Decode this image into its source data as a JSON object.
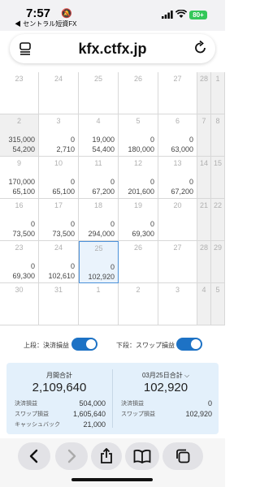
{
  "status": {
    "time": "7:57",
    "carrier": "◀ セントラル短資FX",
    "battery": "80+"
  },
  "browser": {
    "url": "kfx.ctfx.jp"
  },
  "calendar": {
    "rows": [
      [
        {
          "d": "23"
        },
        {
          "d": "24"
        },
        {
          "d": "25"
        },
        {
          "d": "26"
        },
        {
          "d": "27"
        },
        {
          "d": "28"
        },
        {
          "d": "1"
        }
      ],
      [
        {
          "d": "2",
          "v1": "315,000",
          "v2": "54,200"
        },
        {
          "d": "3",
          "v1": "0",
          "v2": "2,710"
        },
        {
          "d": "4",
          "v1": "19,000",
          "v2": "54,400"
        },
        {
          "d": "5",
          "v1": "0",
          "v2": "180,000"
        },
        {
          "d": "6",
          "v1": "0",
          "v2": "63,000"
        },
        {
          "d": "7"
        },
        {
          "d": "8"
        }
      ],
      [
        {
          "d": "9",
          "v1": "170,000",
          "v2": "65,100"
        },
        {
          "d": "10",
          "v1": "0",
          "v2": "65,100"
        },
        {
          "d": "11",
          "v1": "0",
          "v2": "67,200"
        },
        {
          "d": "12",
          "v1": "0",
          "v2": "201,600"
        },
        {
          "d": "13",
          "v1": "0",
          "v2": "67,200"
        },
        {
          "d": "14"
        },
        {
          "d": "15"
        }
      ],
      [
        {
          "d": "16",
          "v1": "0",
          "v2": "73,500"
        },
        {
          "d": "17",
          "v1": "0",
          "v2": "73,500"
        },
        {
          "d": "18",
          "v1": "0",
          "v2": "294,000"
        },
        {
          "d": "19",
          "v1": "0",
          "v2": "69,300"
        },
        {
          "d": "20"
        },
        {
          "d": "21"
        },
        {
          "d": "22"
        }
      ],
      [
        {
          "d": "23",
          "v1": "0",
          "v2": "69,300"
        },
        {
          "d": "24",
          "v1": "0",
          "v2": "102,610"
        },
        {
          "d": "25",
          "v1": "0",
          "v2": "102,920"
        },
        {
          "d": "26"
        },
        {
          "d": "27"
        },
        {
          "d": "28"
        },
        {
          "d": "29"
        }
      ],
      [
        {
          "d": "30"
        },
        {
          "d": "31"
        },
        {
          "d": "1"
        },
        {
          "d": "2"
        },
        {
          "d": "3"
        },
        {
          "d": "4"
        },
        {
          "d": "5"
        }
      ]
    ]
  },
  "toggles": {
    "upper_label": "上段：決済損益",
    "lower_label": "下段：スワップ損益"
  },
  "summary": {
    "monthly_title": "月間合計",
    "monthly_total": "2,109,640",
    "monthly_lines": [
      {
        "k": "決済損益",
        "v": "504,000"
      },
      {
        "k": "スワップ損益",
        "v": "1,605,640"
      },
      {
        "k": "キャッシュバック",
        "v": "21,000"
      }
    ],
    "day_title": "03月25日合計",
    "day_chevron": "⌵",
    "day_total": "102,920",
    "day_lines": [
      {
        "k": "決済損益",
        "v": "0"
      },
      {
        "k": "スワップ損益",
        "v": "102,920"
      }
    ]
  },
  "icons": {
    "menu": "menu-icon",
    "reload": "reload-icon",
    "back": "back-icon",
    "forward": "forward-icon",
    "share": "share-icon",
    "bookmarks": "bookmarks-icon",
    "tabs": "tabs-icon"
  },
  "colors": {
    "accent": "#1d72c5",
    "summary_bg": "#e3f0fb",
    "selected_border": "#4a90d9"
  }
}
